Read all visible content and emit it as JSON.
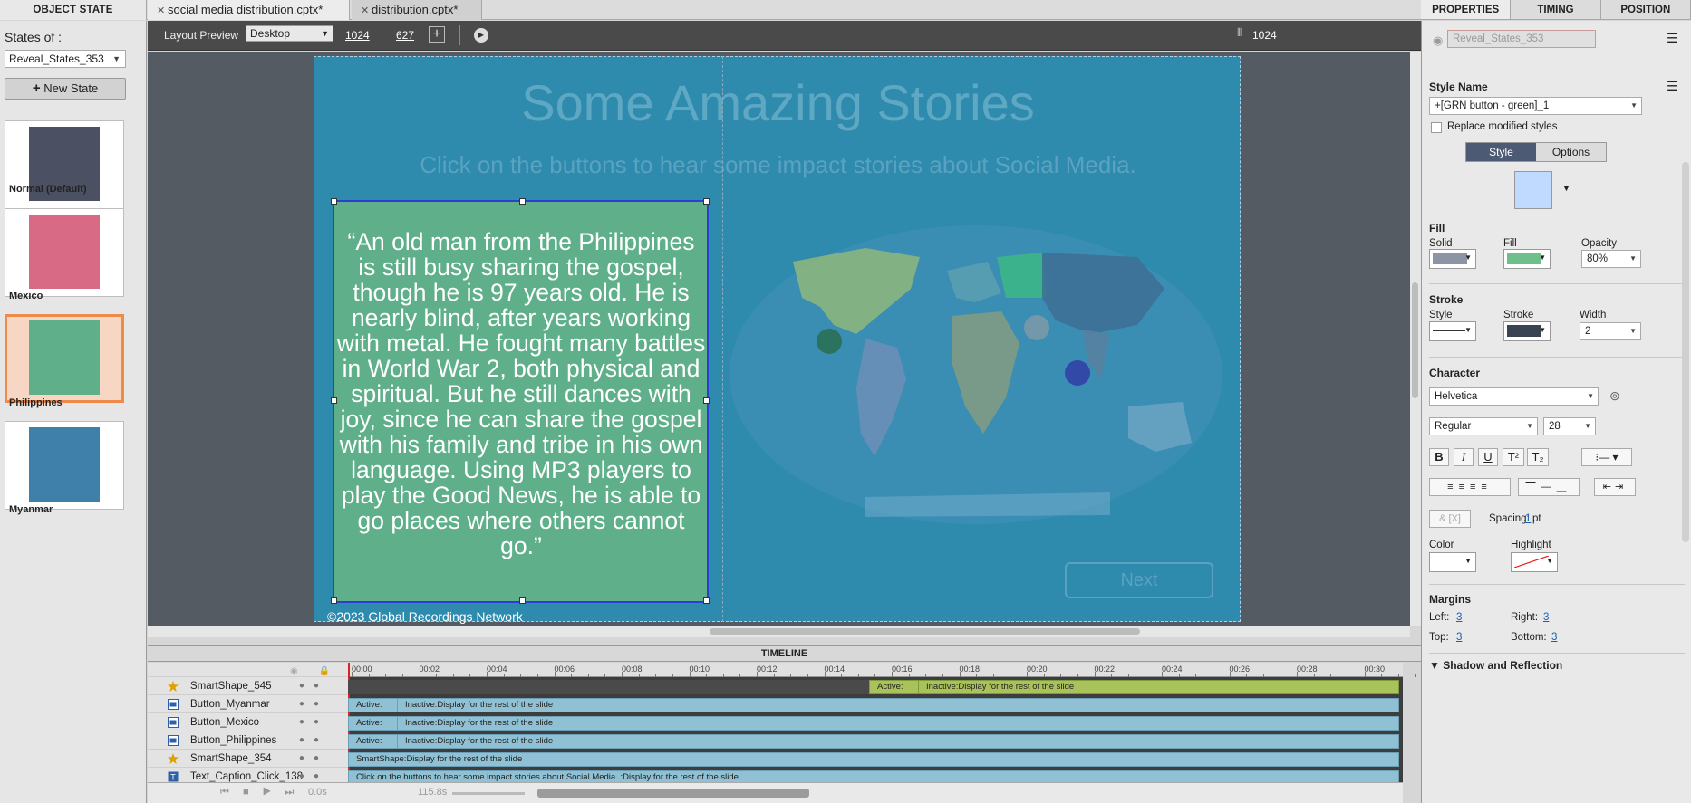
{
  "tabs": {
    "object_state": "OBJECT STATE",
    "doc1": "social media distribution.cptx*",
    "doc2": "distribution.cptx*"
  },
  "prop_tabs": [
    "PROPERTIES",
    "TIMING",
    "POSITION"
  ],
  "left": {
    "states_of": "States of :",
    "selected_object": "Reveal_States_353",
    "new_state": "New State",
    "states": [
      {
        "label": "Normal (Default)",
        "color": "#4b5163"
      },
      {
        "label": "Mexico",
        "color": "#d96a86"
      },
      {
        "label": "Philippines",
        "color": "#5faf8a"
      },
      {
        "label": "Myanmar",
        "color": "#3f80ab"
      }
    ]
  },
  "toolbar": {
    "layout_preview": "Layout Preview",
    "device": "Desktop",
    "width": "1024",
    "height": "627",
    "ruler": "1024"
  },
  "slide": {
    "title": "Some Amazing Stories",
    "subtitle": "Click on the buttons to hear some impact stories about Social Media.",
    "story": "“An old man from the Philippines is still busy sharing the gospel, though he is 97 years old. He is nearly blind, after years working with metal. He fought many battles in World War 2, both physical and spiritual. But he still dances with joy, since he can share the gospel with his family and tribe in his own language. Using MP3 players to play the Good News, he is able to go places where others cannot go.”",
    "copyright": "©2023 Global Recordings Network",
    "next": "Next"
  },
  "timeline": {
    "title": "TIMELINE",
    "ticks": [
      "00:00",
      "00:02",
      "00:04",
      "00:06",
      "00:08",
      "00:10",
      "00:12",
      "00:14",
      "00:16",
      "00:18",
      "00:20",
      "00:22",
      "00:24",
      "00:26",
      "00:28",
      "00:30"
    ],
    "rows": [
      {
        "name": "SmartShape_545",
        "type": "star",
        "bars": [
          {
            "text": "Active:",
            "kind": "green"
          },
          {
            "text": "Inactive:Display for the rest of the slide",
            "kind": "green"
          }
        ]
      },
      {
        "name": "Button_Myanmar",
        "type": "button",
        "bars": [
          {
            "text": "Active:",
            "kind": "blue"
          },
          {
            "text": "Inactive:Display for the rest of the slide",
            "kind": "blue"
          }
        ]
      },
      {
        "name": "Button_Mexico",
        "type": "button",
        "bars": [
          {
            "text": "Active:",
            "kind": "blue"
          },
          {
            "text": "Inactive:Display for the rest of the slide",
            "kind": "blue"
          }
        ]
      },
      {
        "name": "Button_Philippines",
        "type": "button",
        "bars": [
          {
            "text": "Active:",
            "kind": "blue"
          },
          {
            "text": "Inactive:Display for the rest of the slide",
            "kind": "blue"
          }
        ]
      },
      {
        "name": "SmartShape_354",
        "type": "star",
        "bars": [
          {
            "text": "SmartShape:Display for the rest of the slide",
            "kind": "blue"
          }
        ]
      },
      {
        "name": "Text_Caption_Click_138",
        "type": "text",
        "bars": [
          {
            "text": "Click on the buttons to hear some impact stories about Social Media. :Display for the rest of the slide",
            "kind": "blue"
          }
        ]
      }
    ],
    "time_current": "0.0s",
    "time_total": "115.8s"
  },
  "props": {
    "name_value": "Reveal_States_353",
    "style_name_label": "Style Name",
    "style_name": "+[GRN button - green]_1",
    "replace_modified": "Replace modified styles",
    "style_tab": "Style",
    "options_tab": "Options",
    "fill": {
      "header": "Fill",
      "solid": "Solid",
      "fill": "Fill",
      "opacity": "Opacity",
      "opacity_value": "80%",
      "solid_color": "#8d94a3",
      "fill_color": "#6fbf8c"
    },
    "stroke": {
      "header": "Stroke",
      "style": "Style",
      "stroke": "Stroke",
      "width": "Width",
      "width_value": "2",
      "stroke_color": "#3a4352"
    },
    "character": {
      "header": "Character",
      "font": "Helvetica",
      "weight": "Regular",
      "size": "28",
      "spacing_label": "Spacing:",
      "spacing_value": "1",
      "spacing_unit": "pt",
      "color": "Color",
      "highlight": "Highlight"
    },
    "margins": {
      "header": "Margins",
      "left": "Left:",
      "left_v": "3",
      "right": "Right:",
      "right_v": "3",
      "top": "Top:",
      "top_v": "3",
      "bottom": "Bottom:",
      "bottom_v": "3"
    },
    "shadow": "Shadow and Reflection"
  }
}
